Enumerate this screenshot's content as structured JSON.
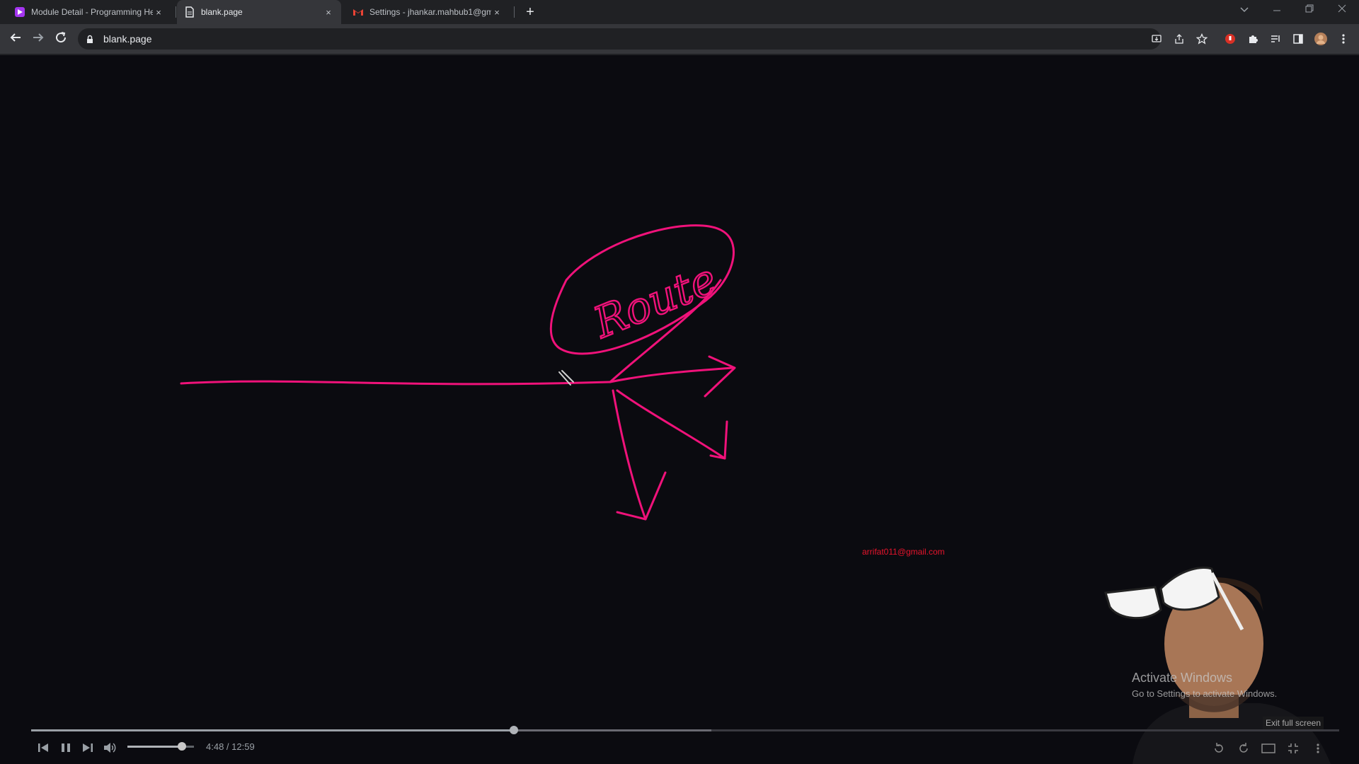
{
  "browser": {
    "tabs": [
      {
        "title": "Module Detail - Programming He",
        "icon": "programming-hero-icon",
        "active": false
      },
      {
        "title": "blank.page",
        "icon": "document-icon",
        "active": true
      },
      {
        "title": "Settings - jhankar.mahbub1@gm",
        "icon": "gmail-icon",
        "active": false
      }
    ],
    "close_glyph": "×",
    "new_tab_glyph": "+",
    "address": "blank.page"
  },
  "page": {
    "drawn_word": "Route",
    "email_watermark": "arrifat011@gmail.com"
  },
  "activate_windows": {
    "line1": "Activate Windows",
    "line2": "Go to Settings to activate Windows."
  },
  "player": {
    "current_time": "4:48",
    "duration": "12:59",
    "time_display": "4:48 / 12:59",
    "progress_fraction": 0.369,
    "buffered_fraction": 0.52,
    "volume_fraction": 0.82,
    "exit_fullscreen_label": "Exit full screen"
  },
  "colors": {
    "ink": "#f0127a",
    "email": "#e8142c",
    "page_background": "#0b0b10"
  }
}
